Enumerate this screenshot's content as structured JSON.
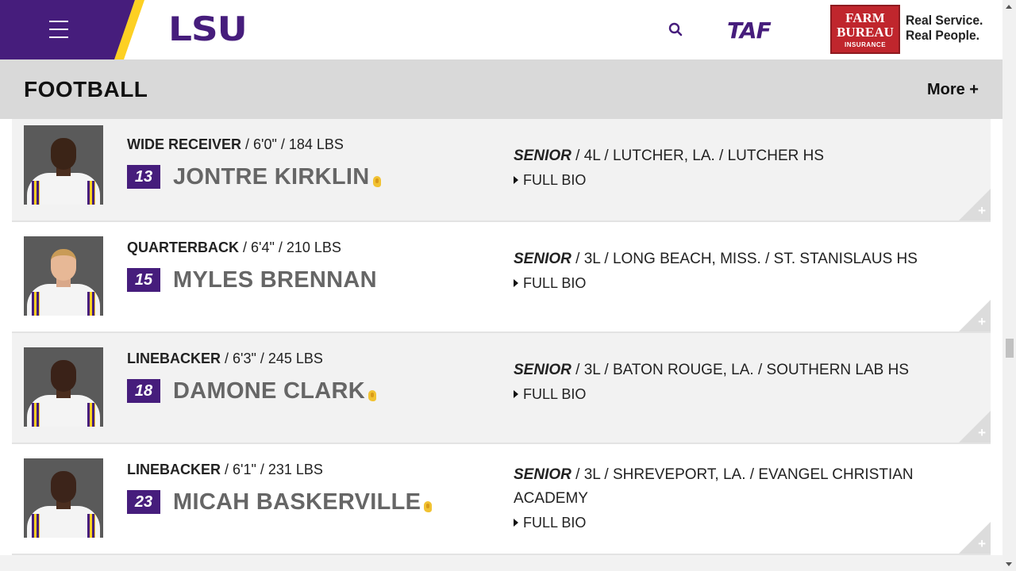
{
  "header": {
    "menu_icon": "hamburger-menu-icon",
    "logo_text": "LSU",
    "search_icon": "search-icon",
    "taf_logo": "TAF",
    "sponsor": {
      "line1": "FARM",
      "line2": "BUREAU",
      "line3": "INSURANCE",
      "tagline1": "Real Service.",
      "tagline2": "Real People."
    }
  },
  "subnav": {
    "title": "FOOTBALL",
    "more": "More +"
  },
  "colors": {
    "purple": "#461d7c",
    "gold": "#fdd023",
    "sponsor_red": "#c0262d"
  },
  "players": [
    {
      "position": "WIDE RECEIVER",
      "measurements": " / 6'0\" / 184 LBS",
      "number": "13",
      "name": "JONTRE KIRKLIN",
      "has_audio": true,
      "class": "SENIOR",
      "details": " / 4L / LUTCHER, LA. / LUTCHER HS",
      "full_bio": "FULL BIO",
      "expand": "+"
    },
    {
      "position": "QUARTERBACK",
      "measurements": " / 6'4\" / 210 LBS",
      "number": "15",
      "name": "MYLES BRENNAN",
      "has_audio": false,
      "class": "SENIOR",
      "details": " / 3L / LONG BEACH, MISS. / ST. STANISLAUS HS",
      "full_bio": "FULL BIO",
      "expand": "+"
    },
    {
      "position": "LINEBACKER",
      "measurements": " / 6'3\" / 245 LBS",
      "number": "18",
      "name": "DAMONE CLARK",
      "has_audio": true,
      "class": "SENIOR",
      "details": " / 3L / BATON ROUGE, LA. / SOUTHERN LAB HS",
      "full_bio": "FULL BIO",
      "expand": "+"
    },
    {
      "position": "LINEBACKER",
      "measurements": " / 6'1\" / 231 LBS",
      "number": "23",
      "name": "MICAH BASKERVILLE",
      "has_audio": true,
      "class": "SENIOR",
      "details": " / 3L / SHREVEPORT, LA. / EVANGEL CHRISTIAN ACADEMY",
      "full_bio": "FULL BIO",
      "expand": "+"
    }
  ]
}
